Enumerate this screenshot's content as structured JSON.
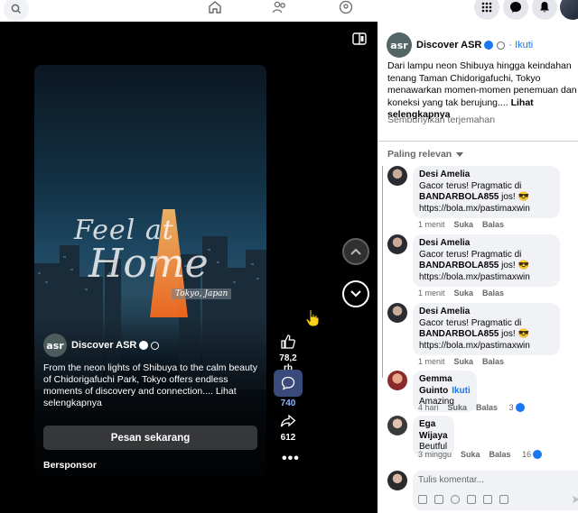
{
  "viewer": {
    "card": {
      "promo_line1": "Feel at",
      "promo_line2": "Home",
      "promo_location": "Tokyo, Japan",
      "page_initials": "asr",
      "page_name": "Discover ASR",
      "caption": "From the neon lights of Shibuya to the calm beauty of Chidorigafuchi Park, Tokyo offers endless moments of discovery and connection.... Lihat selengkapnya",
      "cta": "Pesan sekarang",
      "sponsored": "Bersponsor"
    },
    "actions": {
      "likes": "78,2 rb",
      "comments": "740",
      "shares": "612"
    }
  },
  "pane": {
    "page_initials": "asr",
    "page_name": "Discover ASR",
    "follow": "· Ikuti",
    "caption": "Dari lampu neon Shibuya hingga keindahan tenang Taman Chidorigafuchi, Tokyo menawarkan momen-momen penemuan dan koneksi yang tak berujung....",
    "see_more": "Lihat selengkapnya",
    "hide_translation": "Sembunyikan terjemahan",
    "sort_label": "Paling relevan",
    "comments": [
      {
        "author": "Desi Amelia",
        "line1": "Gacor terus! Pragmatic di",
        "bold": "BANDARBOLA855",
        "line2_suffix": " jos! 😎",
        "link": "https://bola.mx/pastimaxwin",
        "time": "1 menit",
        "like": "Suka",
        "reply": "Balas"
      },
      {
        "author": "Desi Amelia",
        "line1": "Gacor terus! Pragmatic di",
        "bold": "BANDARBOLA855",
        "line2_suffix": " jos! 😎",
        "link": "https://bola.mx/pastimaxwin",
        "time": "1 menit",
        "like": "Suka",
        "reply": "Balas"
      },
      {
        "author": "Desi Amelia",
        "line1": "Gacor terus! Pragmatic di",
        "bold": "BANDARBOLA855",
        "line2_suffix": " jos! 😎",
        "link": "https://bola.mx/pastimaxwin",
        "time": "1 menit",
        "like": "Suka",
        "reply": "Balas"
      },
      {
        "author": "Gemma Guinto",
        "follow": "Ikuti",
        "text": "Amazing",
        "time": "4 hari",
        "like": "Suka",
        "reply": "Balas",
        "reactions": "3"
      },
      {
        "author": "Ega Wijaya",
        "text": "Beutful",
        "time": "3 minggu",
        "like": "Suka",
        "reply": "Balas",
        "reactions": "16"
      }
    ],
    "composer_placeholder": "Tulis komentar..."
  },
  "colors": {
    "accent": "#1877f2",
    "viewer_bg": "#000000",
    "bubble_bg": "#f0f2f5"
  }
}
